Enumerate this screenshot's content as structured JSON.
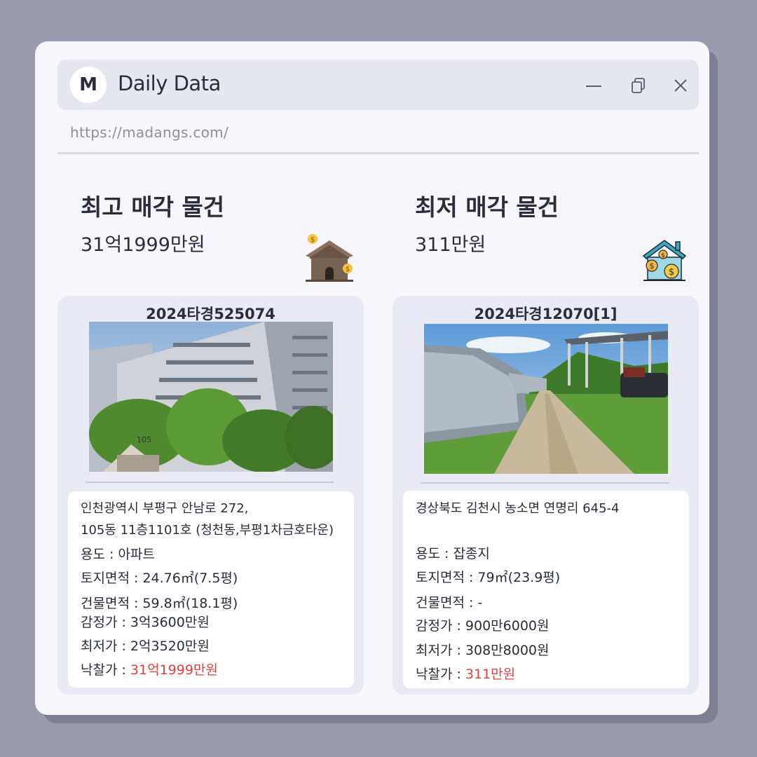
{
  "window": {
    "avatar_letter": "M",
    "title": "Daily Data",
    "url": "https://madangs.com/",
    "controls": {
      "minimize_icon": "minimize-icon",
      "restore_icon": "copy-icon",
      "close_icon": "close-icon"
    }
  },
  "highest": {
    "title": "최고 매각 물건",
    "price": "31억1999만원",
    "icon": "house-with-coins-icon",
    "case_no": "2024타경525074",
    "photo": "apartment-building-photo",
    "address_line1": "인천광역시 부평구 안남로 272,",
    "address_line2": "105동 11층1101호 (청천동,부평1차금호타운)",
    "usage": "용도 : 아파트",
    "land_area": "토지면적 : 24.76㎡(7.5평)",
    "building_area": "건물면적 : 59.8㎡(18.1평)",
    "appraisal": "감정가 : 3억3600만원",
    "minimum": "최저가 : 2억3520만원",
    "winning_label": "낙찰가 : ",
    "winning_value": "31억1999만원"
  },
  "lowest": {
    "title": "최저 매각 물건",
    "price": "311만원",
    "icon": "house-money-icon",
    "case_no": "2024타경12070[1]",
    "photo": "rural-greenhouse-road-photo",
    "address_line1": "경상북도 김천시 농소면 연명리 645-4",
    "usage": "용도 : 잡종지",
    "land_area": "토지면적 : 79㎡(23.9평)",
    "building_area": "건물면적 : -",
    "appraisal": "감정가 : 900만6000원",
    "minimum": "최저가 : 308만8000원",
    "winning_label": "낙찰가 : ",
    "winning_value": "311만원"
  },
  "colors": {
    "accent_red": "#e0413c",
    "background": "#9a9bae",
    "window": "#f6f6fb"
  }
}
